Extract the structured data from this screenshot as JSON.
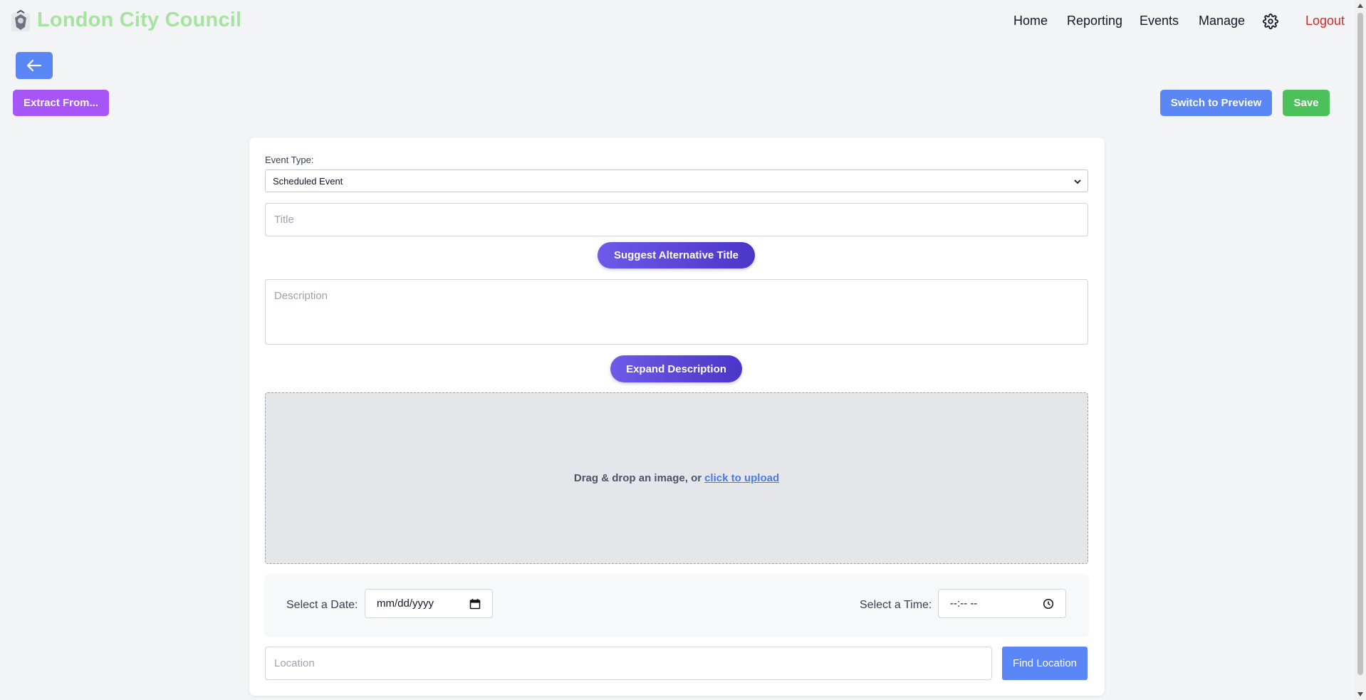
{
  "header": {
    "brand": "London City Council",
    "nav": {
      "home": "Home",
      "reporting": "Reporting",
      "events": "Events",
      "manage": "Manage",
      "logout": "Logout"
    }
  },
  "toolbar": {
    "extract_label": "Extract From...",
    "preview_label": "Switch to Preview",
    "save_label": "Save"
  },
  "form": {
    "event_type_label": "Event Type:",
    "event_type_value": "Scheduled Event",
    "title_placeholder": "Title",
    "suggest_title_label": "Suggest Alternative Title",
    "description_placeholder": "Description",
    "expand_description_label": "Expand Description",
    "dropzone_text": "Drag & drop an image, or",
    "dropzone_link": "click to upload",
    "date_label": "Select a Date:",
    "date_value": "mm/dd/yyyy",
    "time_label": "Select a Time:",
    "time_value": "--:-- --",
    "location_placeholder": "Location",
    "find_location_label": "Find Location"
  },
  "colors": {
    "brand": "#a6e3a1",
    "primary": "#5b86f5",
    "extract": "#a855f7",
    "save": "#4cc05a",
    "logout": "#dc2626",
    "ai_button": "#5b45d6"
  },
  "icons": {
    "logo": "council-crest-icon",
    "settings": "gear-icon",
    "back": "arrow-left-icon",
    "calendar": "calendar-icon",
    "clock": "clock-icon"
  }
}
